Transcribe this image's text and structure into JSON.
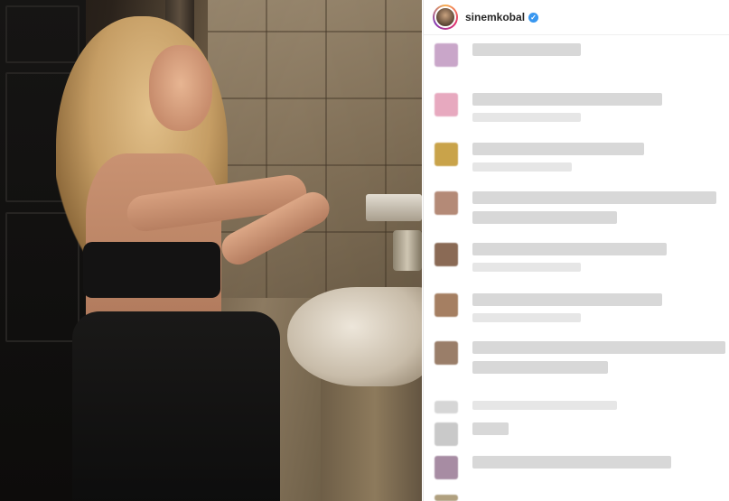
{
  "post": {
    "username": "sinemkobal",
    "verified_icon": "verified-badge-icon"
  },
  "comments": [
    {
      "avatar_color": "#c9a6c9"
    },
    {
      "avatar_color": "#e7a9bf"
    },
    {
      "avatar_color": "#c9a34a"
    },
    {
      "avatar_color": "#b48a77"
    },
    {
      "avatar_color": "#8a6a55"
    },
    {
      "avatar_color": "#a57f62"
    },
    {
      "avatar_color": "#9a7e69"
    },
    {
      "avatar_color": "#c9c9c9"
    },
    {
      "avatar_color": "#a78ca3"
    },
    {
      "avatar_color": "#b0a07f"
    }
  ],
  "colors": {
    "verified": "#3897f0",
    "accent_pink": "#e1306c"
  }
}
